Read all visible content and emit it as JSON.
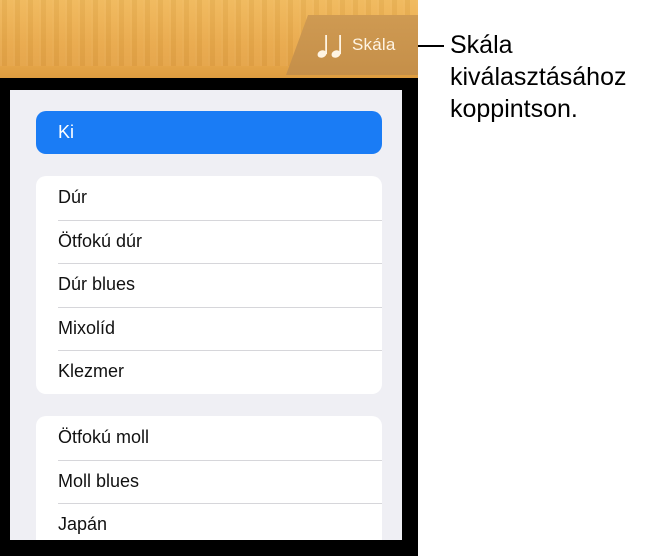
{
  "toolbar": {
    "scale_button": {
      "icon": "music-notes-icon",
      "label": "Skála"
    }
  },
  "scale_menu": {
    "off_label": "Ki",
    "groups": [
      [
        "Dúr",
        "Ötfokú dúr",
        "Dúr blues",
        "Mixolíd",
        "Klezmer"
      ],
      [
        "Ötfokú moll",
        "Moll blues",
        "Japán"
      ]
    ]
  },
  "callout": {
    "text": "Skála\nkiválasztásához\nkoppintson."
  },
  "colors": {
    "wood": "#e9a94a",
    "tab": "#c9934c",
    "selected": "#1a7cf5",
    "panel_bg": "#efeff4"
  }
}
